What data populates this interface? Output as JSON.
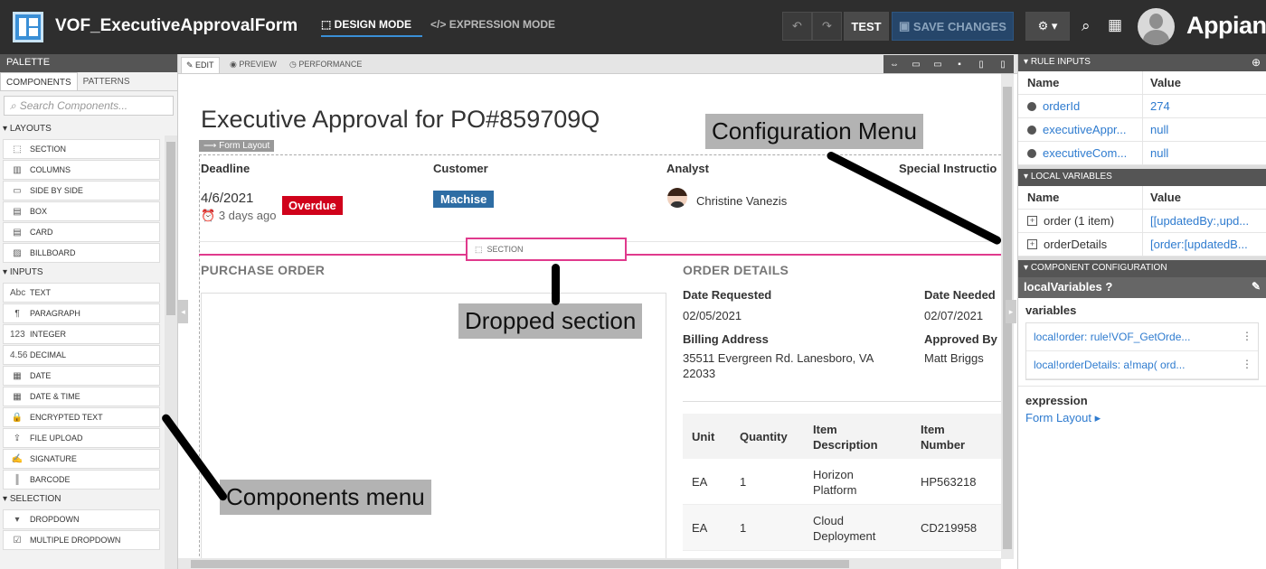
{
  "app": {
    "title": "VOF_ExecutiveApprovalForm",
    "brand": "Appian"
  },
  "modes": {
    "design": "DESIGN MODE",
    "expression": "EXPRESSION MODE"
  },
  "toolbar": {
    "undo": "↶",
    "redo": "↷",
    "test": "TEST",
    "save": "SAVE CHANGES",
    "settings": "⚙ ▾",
    "search_icon": "⌕",
    "grid_icon": "▦"
  },
  "palette": {
    "header": "PALETTE",
    "tabs": [
      "COMPONENTS",
      "PATTERNS"
    ],
    "search_placeholder": "Search Components...",
    "sections": [
      {
        "title": "LAYOUTS",
        "items": [
          {
            "label": "SECTION",
            "icon": "section-icon",
            "glyph": "⬚"
          },
          {
            "label": "COLUMNS",
            "icon": "columns-icon",
            "glyph": "▥"
          },
          {
            "label": "SIDE BY SIDE",
            "icon": "side-by-side-icon",
            "glyph": "▭"
          },
          {
            "label": "BOX",
            "icon": "box-icon",
            "glyph": "▤"
          },
          {
            "label": "CARD",
            "icon": "card-icon",
            "glyph": "▤"
          },
          {
            "label": "BILLBOARD",
            "icon": "billboard-icon",
            "glyph": "▨"
          }
        ]
      },
      {
        "title": "INPUTS",
        "items": [
          {
            "label": "TEXT",
            "icon": "text-icon",
            "glyph": "Abc"
          },
          {
            "label": "PARAGRAPH",
            "icon": "paragraph-icon",
            "glyph": "¶"
          },
          {
            "label": "INTEGER",
            "icon": "integer-icon",
            "glyph": "123"
          },
          {
            "label": "DECIMAL",
            "icon": "decimal-icon",
            "glyph": "4.56"
          },
          {
            "label": "DATE",
            "icon": "calendar-icon",
            "glyph": "▦"
          },
          {
            "label": "DATE & TIME",
            "icon": "date-time-icon",
            "glyph": "▦"
          },
          {
            "label": "ENCRYPTED TEXT",
            "icon": "lock-icon",
            "glyph": "🔒"
          },
          {
            "label": "FILE UPLOAD",
            "icon": "upload-icon",
            "glyph": "⇪"
          },
          {
            "label": "SIGNATURE",
            "icon": "signature-icon",
            "glyph": "✍"
          },
          {
            "label": "BARCODE",
            "icon": "barcode-icon",
            "glyph": "║"
          }
        ]
      },
      {
        "title": "SELECTION",
        "items": [
          {
            "label": "DROPDOWN",
            "icon": "dropdown-icon",
            "glyph": "▾"
          },
          {
            "label": "MULTIPLE DROPDOWN",
            "icon": "multiple-dropdown-icon",
            "glyph": "☑"
          }
        ]
      }
    ]
  },
  "canvas": {
    "tabs": [
      "EDIT",
      "PREVIEW",
      "PERFORMANCE"
    ],
    "form_title": "Executive Approval for PO#859709Q",
    "form_layout_tag": "⟶ Form Layout",
    "columns": [
      "Deadline",
      "Customer",
      "Analyst",
      "Special Instructio"
    ],
    "deadline_date": "4/6/2021",
    "deadline_ago_num": "3",
    "deadline_ago_text": " days ago",
    "status_badge": "Overdue",
    "customer": "Machise",
    "analyst": "Christine Vanezis",
    "dropped_section_label": "SECTION",
    "purchase_order_title": "PURCHASE ORDER",
    "order_details_title": "ORDER DETAILS",
    "details": {
      "date_requested_label": "Date Requested",
      "date_requested": "02/05/2021",
      "date_needed_label": "Date Needed",
      "date_needed": "02/07/2021",
      "billing_label": "Billing Address",
      "billing_line1": "35511 Evergreen Rd. Lanesboro, VA",
      "billing_line2": "22033",
      "approved_label": "Approved By",
      "approved_by": "Matt Briggs"
    },
    "table": {
      "headers": [
        "Unit",
        "Quantity",
        "Item",
        "Description",
        "Item",
        "Number"
      ],
      "rows": [
        {
          "unit": "EA",
          "qty": "1",
          "desc1": "Horizon",
          "desc2": "Platform",
          "num": "HP563218"
        },
        {
          "unit": "EA",
          "qty": "1",
          "desc1": "Cloud",
          "desc2": "Deployment",
          "num": "CD219958"
        }
      ]
    }
  },
  "annotations": {
    "config_menu": "Configuration Menu",
    "dropped_section": "Dropped section",
    "components_menu": "Components menu"
  },
  "right_panel": {
    "rule_inputs_title": "RULE INPUTS",
    "name_col": "Name",
    "value_col": "Value",
    "rule_inputs": [
      {
        "name": "orderId",
        "value": "274"
      },
      {
        "name": "executiveAppr...",
        "value": "null"
      },
      {
        "name": "executiveCom...",
        "value": "null"
      }
    ],
    "local_vars_title": "LOCAL VARIABLES",
    "local_vars": [
      {
        "name": "order (1 item)",
        "value": "[[updatedBy:,upd..."
      },
      {
        "name": "orderDetails",
        "value": "[order:[updatedB..."
      }
    ],
    "component_config_title": "COMPONENT CONFIGURATION",
    "component_name": "localVariables",
    "variables_label": "variables",
    "variables": [
      "local!order: rule!VOF_GetOrde...",
      "local!orderDetails: a!map( ord..."
    ],
    "expression_label": "expression",
    "expression_value": "Form Layout ▸"
  },
  "colors": {
    "accent": "#3a8fd6",
    "drop_highlight": "#e03a8d",
    "overdue": "#d0021b",
    "customer_badge": "#2e6da4",
    "topbar": "#2e2e2e"
  }
}
